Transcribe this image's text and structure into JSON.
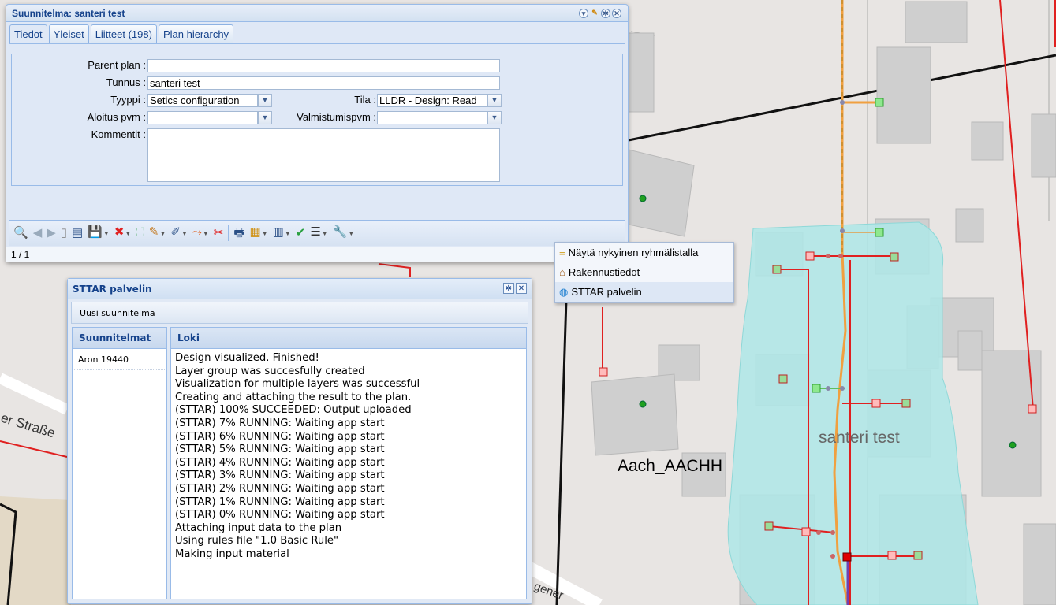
{
  "map": {
    "labels": {
      "street1": "er Straße",
      "street2": "gener",
      "area": "Aach_AACHH",
      "plan": "santeri test"
    }
  },
  "plan_window": {
    "title": "Suunnitelma: santeri test",
    "tabs": [
      {
        "label": "Tiedot"
      },
      {
        "label": "Yleiset"
      },
      {
        "label": "Liitteet (198)"
      },
      {
        "label": "Plan hierarchy"
      }
    ],
    "form": {
      "parent_plan_label": "Parent plan :",
      "parent_plan_value": "",
      "tunnus_label": "Tunnus :",
      "tunnus_value": "santeri test",
      "tyyppi_label": "Tyyppi :",
      "tyyppi_value": "Setics configuration",
      "tila_label": "Tila :",
      "tila_value": "LLDR - Design: Read",
      "aloitus_label": "Aloitus pvm :",
      "aloitus_value": "",
      "valmistumis_label": "Valmistumispvm :",
      "valmistumis_value": "",
      "kommentit_label": "Kommentit :",
      "kommentit_value": ""
    },
    "paging": "1 / 1"
  },
  "context_menu": {
    "items": [
      {
        "label": "Näytä nykyinen ryhmälistalla",
        "icon": "layers-icon"
      },
      {
        "label": "Rakennustiedot",
        "icon": "house-icon"
      },
      {
        "label": "STTAR palvelin",
        "icon": "globe-icon"
      }
    ]
  },
  "sttar_window": {
    "title": "STTAR palvelin",
    "new_plan": "Uusi suunnitelma",
    "plans_header": "Suunnitelmat",
    "plans": [
      "Aron 19440"
    ],
    "log_header": "Loki",
    "log": [
      "Design visualized. Finished!",
      "Layer group was succesfully created",
      "Visualization for multiple layers was successful",
      "Creating and attaching the result to the plan.",
      "(STTAR) 100% SUCCEEDED: Output uploaded",
      "(STTAR) 7% RUNNING: Waiting app start",
      "(STTAR) 6% RUNNING: Waiting app start",
      "(STTAR) 5% RUNNING: Waiting app start",
      "(STTAR) 4% RUNNING: Waiting app start",
      "(STTAR) 3% RUNNING: Waiting app start",
      "(STTAR) 2% RUNNING: Waiting app start",
      "(STTAR) 1% RUNNING: Waiting app start",
      "(STTAR) 0% RUNNING: Waiting app start",
      "Attaching input data to the plan",
      "Using rules file \"1.0 Basic Rule\"",
      "Making input material"
    ]
  },
  "colors": {
    "plan_area": "#aee8e8",
    "cable_red": "#e02020",
    "cable_orange": "#f0a040",
    "building": "#cfcfcf",
    "window_blue": "#15428b"
  }
}
